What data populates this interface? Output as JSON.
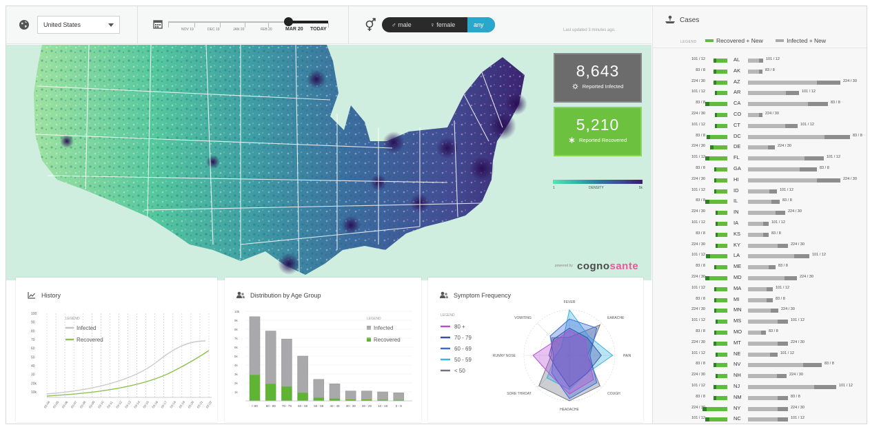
{
  "topbar": {
    "country": "United States",
    "timeline_labels": [
      "NOV 19",
      "DEC 19",
      "JAN 20",
      "FEB 20",
      "MAR 20",
      "TODAY"
    ],
    "gender_options": [
      "male",
      "female",
      "any"
    ],
    "gender_selected": "any",
    "updated": "Last updated 3 minutes ago."
  },
  "map": {
    "reported_infected_value": "8,643",
    "reported_infected_label": "Reported Infected",
    "reported_recovered_value": "5,210",
    "reported_recovered_label": "Reported Recovered",
    "density_min": "1",
    "density_label": "DENSITY",
    "density_max": "5k",
    "powered_by": "powered by",
    "logo_a": "cogno",
    "logo_b": "sante"
  },
  "history": {
    "title": "History",
    "legend_label": "LEGEND",
    "series": [
      {
        "name": "Infected",
        "color": "#c4c4c4"
      },
      {
        "name": "Recovered",
        "color": "#8cc152"
      }
    ],
    "y_ticks": [
      "10k",
      "20k",
      "30",
      "40",
      "50",
      "60",
      "70",
      "80",
      "90",
      "100"
    ],
    "x_ticks": [
      "03-04",
      "03-05",
      "03-06",
      "03-07",
      "03-08",
      "03-09",
      "03-10",
      "03-11",
      "03-12",
      "03-13",
      "03-14",
      "03-15",
      "03-16",
      "03-17",
      "03-18",
      "03-19",
      "03-20",
      "03-21",
      "03-22"
    ]
  },
  "age": {
    "title": "Distribution by Age Group",
    "legend_label": "LEGEND",
    "legend": [
      {
        "name": "Infected",
        "color": "#a9a9ab"
      },
      {
        "name": "Recovered",
        "color": "#5fb533"
      }
    ],
    "y_ticks": [
      "1k",
      "2k",
      "3k",
      "4k",
      "5k",
      "6k",
      "7k",
      "8k",
      "9k",
      "10k"
    ],
    "chart_data": {
      "type": "bar",
      "categories": [
        "> 90",
        "80 - 89",
        "70 - 79",
        "60 - 69",
        "50 - 59",
        "40 - 49",
        "30 - 39",
        "20 - 29",
        "10 - 19",
        "0 - 9"
      ],
      "series": [
        {
          "name": "Infected",
          "values": [
            9400,
            7800,
            6900,
            5000,
            2400,
            1900,
            1100,
            1100,
            1000,
            900
          ]
        },
        {
          "name": "Recovered",
          "values": [
            2900,
            1900,
            1600,
            900,
            350,
            250,
            150,
            150,
            120,
            100
          ]
        }
      ],
      "ylim": [
        0,
        10000
      ]
    }
  },
  "symptom": {
    "title": "Symptom Frequency",
    "legend_label": "LEGEND",
    "legend": [
      {
        "name": "80 +",
        "color": "#b64ed6"
      },
      {
        "name": "70 - 79",
        "color": "#3d4fa8"
      },
      {
        "name": "60 - 69",
        "color": "#3a6ad8"
      },
      {
        "name": "50 - 59",
        "color": "#39b3e0"
      },
      {
        "name": "< 50",
        "color": "#6f7480"
      }
    ],
    "axes": [
      "FEVER",
      "EARACHE",
      "PAIN",
      "COUGH",
      "HEADACHE",
      "SORE THROAT",
      "RUNNY NOSE",
      "VOMITING"
    ]
  },
  "cases": {
    "title": "Cases",
    "legend_label": "LEGEND",
    "legend": [
      {
        "name": "Recovered + New",
        "color": "#5fbd3b"
      },
      {
        "name": "Infected + New",
        "color": "#a9a9a9"
      }
    ],
    "rows": [
      {
        "state": "AL",
        "rec": "101 / 12",
        "g": 0.44,
        "inf": "101 / 12",
        "y": 0.1
      },
      {
        "state": "AK",
        "rec": "83 / 8",
        "g": 0.44,
        "inf": "83 / 8",
        "y": 0.09
      },
      {
        "state": "AZ",
        "rec": "224 / 30",
        "g": 0.44,
        "inf": "224 / 30",
        "y": 0.9
      },
      {
        "state": "AR",
        "rec": "101 / 12",
        "g": 0.36,
        "inf": "101 / 12",
        "y": 0.47
      },
      {
        "state": "CA",
        "rec": "83 / 8",
        "g": 0.86,
        "inf": "83 / 8",
        "y": 0.77
      },
      {
        "state": "CO",
        "rec": "224 / 30",
        "g": 0.36,
        "inf": "224 / 30",
        "y": 0.09
      },
      {
        "state": "CT",
        "rec": "101 / 12",
        "g": 0.36,
        "inf": "101 / 12",
        "y": 0.46
      },
      {
        "state": "DC",
        "rec": "83 / 8",
        "g": 0.8,
        "inf": "83 / 8",
        "y": 1.0
      },
      {
        "state": "DE",
        "rec": "224 / 30",
        "g": 0.6,
        "inf": "224 / 30",
        "y": 0.22
      },
      {
        "state": "FL",
        "rec": "101 / 12",
        "g": 0.86,
        "inf": "101 / 12",
        "y": 0.73
      },
      {
        "state": "GA",
        "rec": "83 / 8",
        "g": 0.4,
        "inf": "83 / 8",
        "y": 0.66
      },
      {
        "state": "HI",
        "rec": "224 / 30",
        "g": 0.4,
        "inf": "224 / 30",
        "y": 0.9
      },
      {
        "state": "ID",
        "rec": "101 / 12",
        "g": 0.4,
        "inf": "101 / 12",
        "y": 0.24
      },
      {
        "state": "IL",
        "rec": "83 / 8",
        "g": 0.86,
        "inf": "83 / 8",
        "y": 0.27
      },
      {
        "state": "IN",
        "rec": "224 / 30",
        "g": 0.32,
        "inf": "224 / 30",
        "y": 0.33
      },
      {
        "state": "IA",
        "rec": "101 / 12",
        "g": 0.32,
        "inf": "101 / 12",
        "y": 0.16
      },
      {
        "state": "KS",
        "rec": "83 / 8",
        "g": 0.32,
        "inf": "83 / 8",
        "y": 0.16
      },
      {
        "state": "KY",
        "rec": "224 / 30",
        "g": 0.32,
        "inf": "224 / 30",
        "y": 0.36
      },
      {
        "state": "LA",
        "rec": "101 / 12",
        "g": 0.82,
        "inf": "101 / 12",
        "y": 0.58
      },
      {
        "state": "ME",
        "rec": "83 / 8",
        "g": 0.4,
        "inf": "83 / 8",
        "y": 0.23
      },
      {
        "state": "MD",
        "rec": "224 / 30",
        "g": 0.86,
        "inf": "224 / 30",
        "y": 0.45
      },
      {
        "state": "MA",
        "rec": "101 / 12",
        "g": 0.4,
        "inf": "101 / 12",
        "y": 0.2
      },
      {
        "state": "MI",
        "rec": "83 / 8",
        "g": 0.4,
        "inf": "83 / 8",
        "y": 0.2
      },
      {
        "state": "MN",
        "rec": "224 / 30",
        "g": 0.4,
        "inf": "224 / 30",
        "y": 0.26
      },
      {
        "state": "MS",
        "rec": "101 / 12",
        "g": 0.32,
        "inf": "101 / 12",
        "y": 0.36
      },
      {
        "state": "MO",
        "rec": "83 / 8",
        "g": 0.4,
        "inf": "83 / 8",
        "y": 0.13
      },
      {
        "state": "MT",
        "rec": "224 / 30",
        "g": 0.44,
        "inf": "224 / 30",
        "y": 0.36
      },
      {
        "state": "NE",
        "rec": "101 / 12",
        "g": 0.32,
        "inf": "101 / 12",
        "y": 0.25
      },
      {
        "state": "NV",
        "rec": "83 / 8",
        "g": 0.44,
        "inf": "83 / 8",
        "y": 0.71
      },
      {
        "state": "NH",
        "rec": "224 / 30",
        "g": 0.32,
        "inf": "224 / 30",
        "y": 0.34
      },
      {
        "state": "NJ",
        "rec": "101 / 12",
        "g": 0.44,
        "inf": "101 / 12",
        "y": 0.86
      },
      {
        "state": "NM",
        "rec": "83 / 8",
        "g": 0.44,
        "inf": "83 / 8",
        "y": 0.36
      },
      {
        "state": "NY",
        "rec": "224 / 30",
        "g": 1.0,
        "inf": "224 / 30",
        "y": 0.36
      },
      {
        "state": "NC",
        "rec": "101 / 12",
        "g": 0.86,
        "inf": "101 / 12",
        "y": 0.36
      }
    ]
  }
}
